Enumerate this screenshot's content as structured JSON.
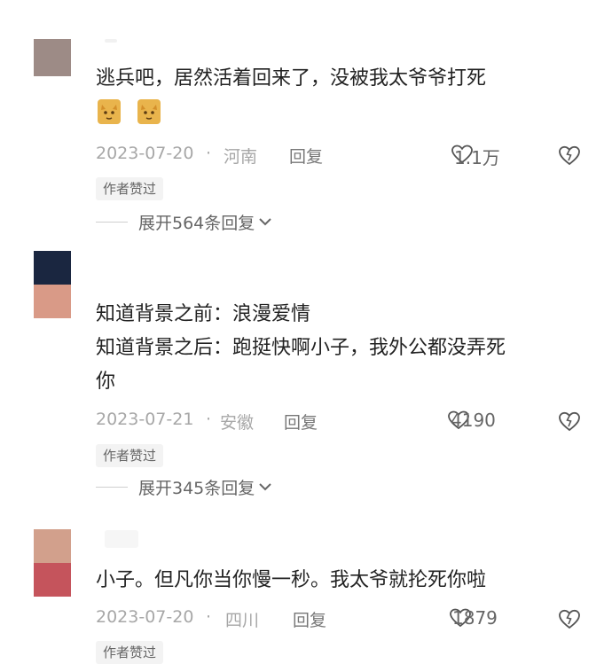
{
  "comments": [
    {
      "text_lines": [
        "逃兵吧，居然活着回来了，没被我太爷爷打死"
      ],
      "sticker_count": 2,
      "date": "2023-07-20",
      "sep": "·",
      "location": "河南",
      "reply_label": "回复",
      "likes": "1.1万",
      "tag": "作者赞过",
      "expand_label": "展开564条回复",
      "avatar_colors": [
        "#9d8b86"
      ]
    },
    {
      "text_lines": [
        "知道背景之前：浪漫爱情",
        "知道背景之后：跑挺快啊小子，我外公都没弄死",
        "你"
      ],
      "date": "2023-07-21",
      "sep": "·",
      "location": "安徽",
      "reply_label": "回复",
      "likes": "4190",
      "tag": "作者赞过",
      "expand_label": "展开345条回复",
      "avatar_colors": [
        "#1a2640",
        "#d99a87"
      ]
    },
    {
      "text_lines": [
        "小子。但凡你当你慢一秒。我太爷就抡死你啦"
      ],
      "date": "2023-07-20",
      "sep": "·",
      "location": "四川",
      "reply_label": "回复",
      "likes": "1879",
      "tag": "作者赞过",
      "avatar_colors": [
        "#d2a08c",
        "#c5545c"
      ]
    }
  ],
  "colors": {
    "text": "#222222",
    "meta": "#a7a7a7",
    "sticker": "#e9b44c"
  },
  "icons": [
    "heart-icon",
    "dislike-icon",
    "chevron-down-icon"
  ]
}
